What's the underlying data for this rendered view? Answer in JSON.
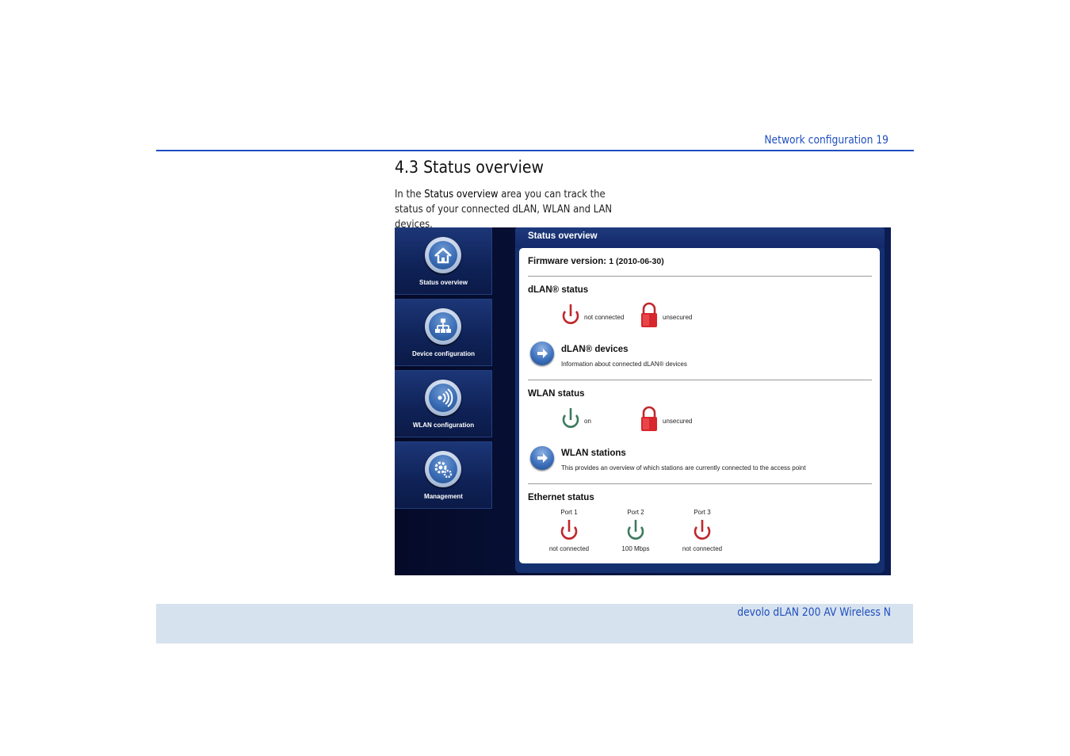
{
  "header": {
    "running_head": "Network configuration 19"
  },
  "section": {
    "title": "4.3  Status overview",
    "intro_before": "In the ",
    "intro_bold": "Status overview",
    "intro_after": " area you can track the status of your connected dLAN, WLAN and LAN devices."
  },
  "screenshot": {
    "nav": [
      {
        "label": "Status overview",
        "icon": "home-icon"
      },
      {
        "label": "Device configuration",
        "icon": "network-icon"
      },
      {
        "label": "WLAN configuration",
        "icon": "wireless-icon"
      },
      {
        "label": "Management",
        "icon": "gears-icon"
      }
    ],
    "panel_title": "Status overview",
    "firmware_label": "Firmware version: ",
    "firmware_value": "1 (2010-06-30)",
    "dlan": {
      "heading": "dLAN® status",
      "connection": "not connected",
      "security": "unsecured",
      "devices_title": "dLAN® devices",
      "devices_desc": "Information about connected dLAN® devices"
    },
    "wlan": {
      "heading": "WLAN status",
      "state": "on",
      "security": "unsecured",
      "stations_title": "WLAN stations",
      "stations_desc": "This provides an overview of which stations are currently connected to the access point"
    },
    "ethernet": {
      "heading": "Ethernet status",
      "ports": [
        {
          "name": "Port 1",
          "status": "not connected"
        },
        {
          "name": "Port 2",
          "status": "100 Mbps"
        },
        {
          "name": "Port 3",
          "status": "not connected"
        }
      ]
    },
    "colors": {
      "red": "#c0272d",
      "green": "#3d7b5e",
      "blue": "#1f4fbf"
    }
  },
  "footer": {
    "product": "devolo dLAN 200 AV Wireless N"
  }
}
